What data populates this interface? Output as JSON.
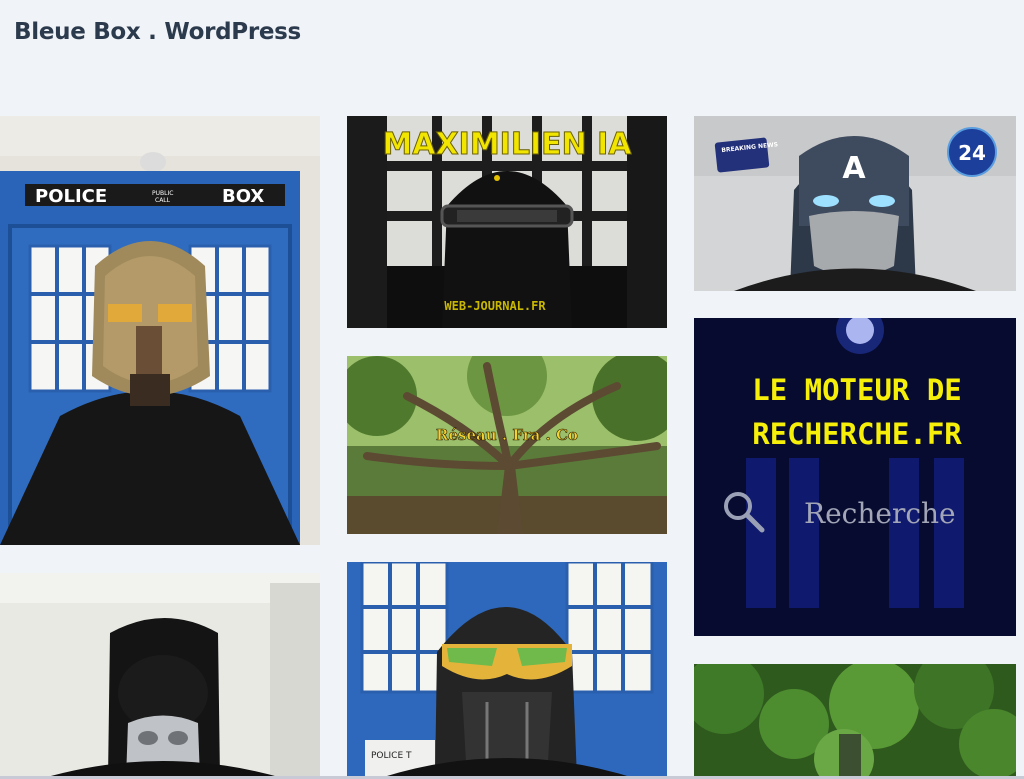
{
  "site": {
    "title": "Bleue Box . WordPress"
  },
  "gallery": {
    "items": [
      {
        "name": "police-box-spartan-helmet",
        "lines": [
          "POLICE",
          "PUBLIC",
          "CALL",
          "BOX"
        ]
      },
      {
        "name": "maximilien-ia",
        "title": "MAXIMILIEN IA",
        "caption": "WEB-JOURNAL.FR"
      },
      {
        "name": "captain-mask-news",
        "badge": "BREAKING NEWS",
        "letter": "A",
        "channel": "24"
      },
      {
        "name": "reseau-fra-co",
        "caption": "Réseau . Fra . Co"
      },
      {
        "name": "le-moteur-de-recherche",
        "line1": "LE MOTEUR DE",
        "line2": "RECHERCHE.FR",
        "search": "Recherche"
      },
      {
        "name": "balaclava-mask-room"
      },
      {
        "name": "police-box-sunglasses",
        "sign": "POLICE T"
      },
      {
        "name": "forest-green"
      }
    ]
  }
}
